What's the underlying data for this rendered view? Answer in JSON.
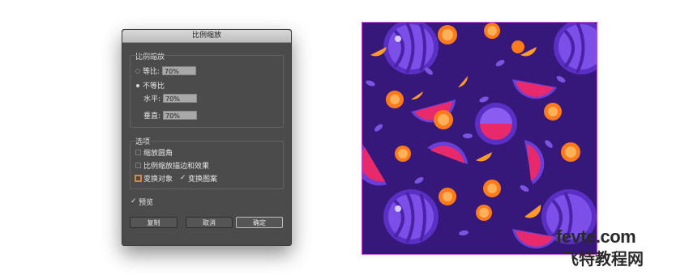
{
  "dialog": {
    "title": "比例缩放",
    "scale_group": {
      "label": "比例缩放",
      "uniform_label": "等比:",
      "uniform_value": "70%",
      "non_uniform_label": "不等比",
      "horizontal_label": "水平:",
      "horizontal_value": "70%",
      "vertical_label": "垂直:",
      "vertical_value": "70%"
    },
    "options_group": {
      "label": "选项",
      "scale_corners": "缩放圆角",
      "scale_strokes": "比例缩放描边和效果",
      "transform_objects": "变换对象",
      "transform_patterns": "变换图案"
    },
    "preview_label": "预览",
    "buttons": {
      "copy": "复制",
      "cancel": "取消",
      "ok": "确定"
    }
  },
  "watermark": {
    "site": "fevte.com",
    "name": "飞特教程网"
  },
  "colors": {
    "pattern_bg": "#36177a",
    "melon": "#6a3fd8",
    "pink": "#e8296b",
    "orange": "#ff7a1a",
    "leaf": "#7b55e0"
  }
}
